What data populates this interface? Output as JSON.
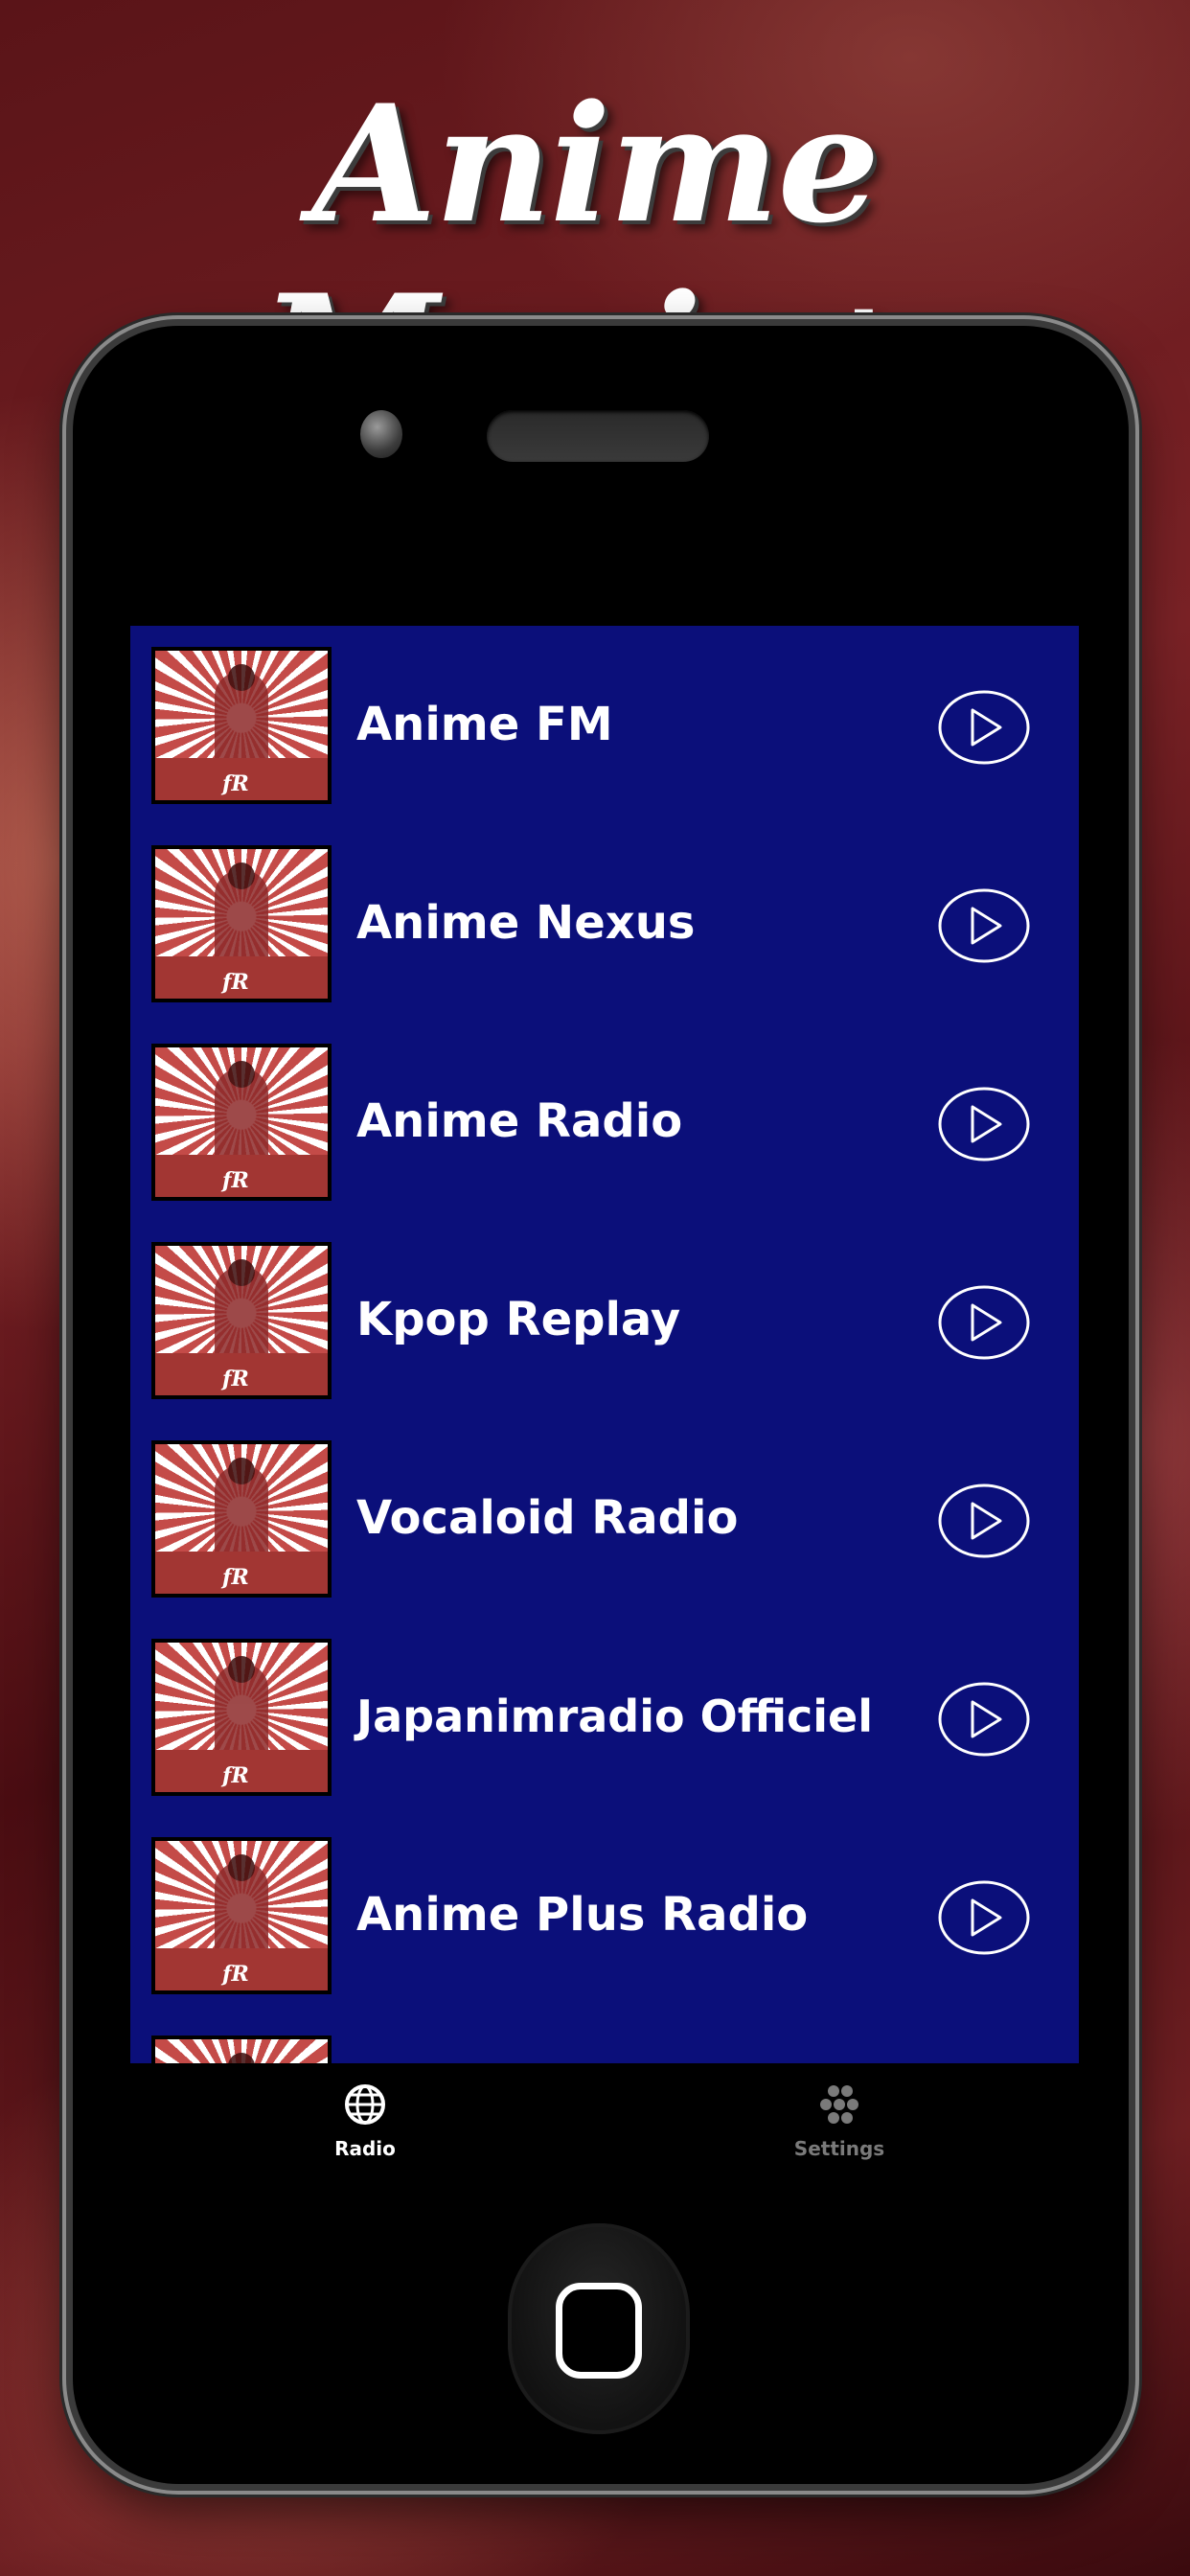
{
  "headline": "Anime Music+",
  "stations": [
    {
      "name": "Anime FM"
    },
    {
      "name": "Anime Nexus"
    },
    {
      "name": "Anime Radio"
    },
    {
      "name": "Kpop Replay"
    },
    {
      "name": "Vocaloid Radio"
    },
    {
      "name": "Japanimradio Officiel"
    },
    {
      "name": "Anime Plus Radio"
    }
  ],
  "thumbnail_mark": "fR",
  "tabs": [
    {
      "label": "Radio",
      "icon": "globe-icon",
      "active": true
    },
    {
      "label": "Settings",
      "icon": "settings-dots-icon",
      "active": false
    }
  ],
  "colors": {
    "list_background": "#0b0f7a",
    "tab_active": "#ffffff",
    "tab_inactive": "#7a7a7a"
  }
}
